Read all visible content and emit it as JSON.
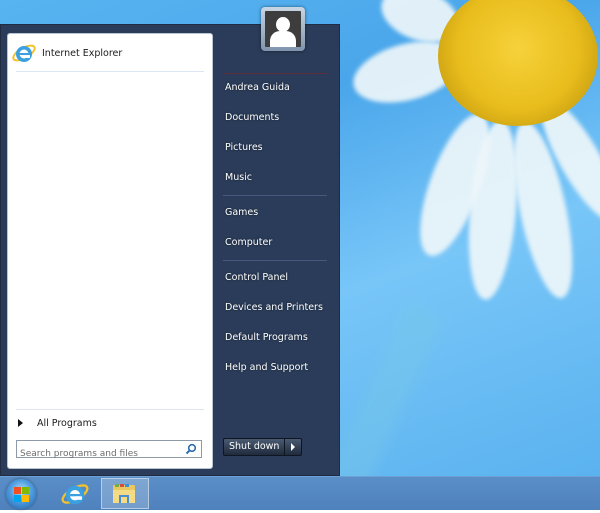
{
  "start_menu": {
    "pinned": [
      {
        "label": "Internet Explorer",
        "icon": "internet-explorer-icon"
      }
    ],
    "all_programs_label": "All Programs",
    "search": {
      "placeholder": "Search programs and files",
      "value": "",
      "icon": "search-icon"
    },
    "user_tile_icon": "user-avatar-icon",
    "right_items": [
      {
        "label": "Andrea Guida"
      },
      {
        "label": "Documents"
      },
      {
        "label": "Pictures"
      },
      {
        "label": "Music"
      },
      {
        "label": "Games"
      },
      {
        "label": "Computer"
      },
      {
        "label": "Control Panel"
      },
      {
        "label": "Devices and Printers"
      },
      {
        "label": "Default Programs"
      },
      {
        "label": "Help and Support"
      }
    ],
    "shutdown_label": "Shut down",
    "shutdown_options_icon": "chevron-right-icon"
  },
  "taskbar": {
    "items": [
      {
        "name": "start-button",
        "icon": "windows-logo-icon"
      },
      {
        "name": "internet-explorer",
        "icon": "internet-explorer-icon"
      },
      {
        "name": "file-explorer",
        "icon": "folder-icon",
        "active": true
      }
    ]
  },
  "colors": {
    "menu_dark": "#2a3c59",
    "menu_left": "#ffffff",
    "taskbar": "#5487c2",
    "wallpaper_sky": "#58b4f0"
  }
}
